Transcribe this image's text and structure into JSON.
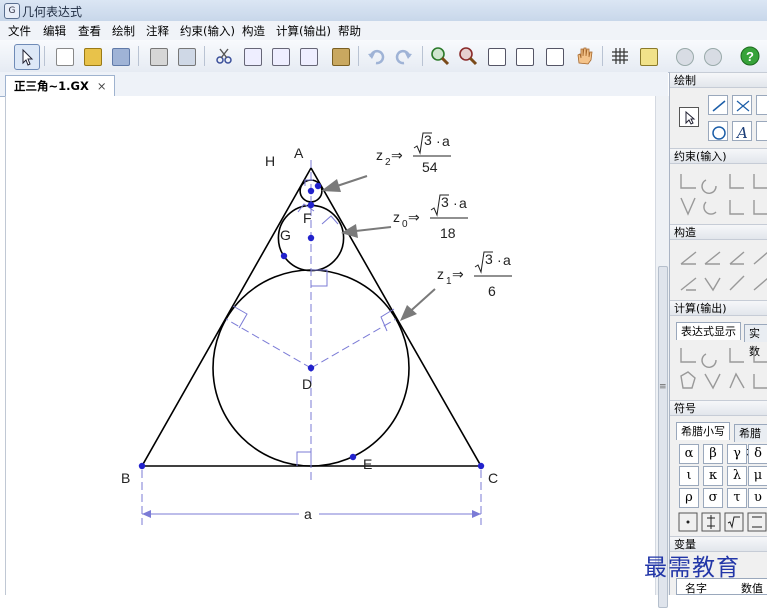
{
  "window": {
    "title": "几何表达式",
    "icon": "app-logo-icon"
  },
  "menu": [
    "文件",
    "编辑",
    "查看",
    "绘制",
    "注释",
    "约束(输入)",
    "构造",
    "计算(输出)",
    "帮助"
  ],
  "document_tab": {
    "label": "正三角~1.GX",
    "close": "×"
  },
  "points": {
    "A": "A",
    "B": "B",
    "C": "C",
    "D": "D",
    "E": "E",
    "F": "F",
    "G": "G",
    "H": "H"
  },
  "dimension_label": "a",
  "formulas": [
    {
      "lhs": "z",
      "sub": "2",
      "arrow": "⇒",
      "num_a": "a",
      "den": "54"
    },
    {
      "lhs": "z",
      "sub": "0",
      "arrow": "⇒",
      "num_a": "a",
      "den": "18"
    },
    {
      "lhs": "z",
      "sub": "1",
      "arrow": "⇒",
      "num_a": "a",
      "den": "6"
    }
  ],
  "formula_root": "3",
  "panel": {
    "draw_title": "绘制",
    "constraint_title": "约束(输入)",
    "construct_title": "构造",
    "calc_title": "计算(输出)",
    "calc_tabs": [
      "表达式显示",
      "实数"
    ],
    "symbol_title": "符号",
    "symbol_tabs": [
      "希腊小写",
      "希腊大"
    ],
    "greek": [
      "α",
      "β",
      "γ",
      "δ",
      "ι",
      "κ",
      "λ",
      "μ",
      "ρ",
      "σ",
      "τ",
      "υ"
    ],
    "variable_title": "变量",
    "variable_cols": [
      "名字",
      "数值"
    ]
  },
  "watermark": "最需教育",
  "colors": {
    "accent": "#2222cc",
    "construction": "#7b7bd6",
    "arrow": "#7a7a7a"
  }
}
